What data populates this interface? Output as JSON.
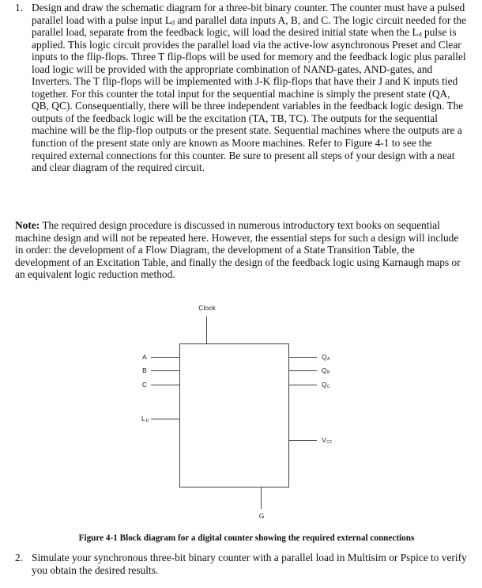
{
  "document": {
    "item1": {
      "number": "1.",
      "text_before_ld1": "Design and draw the schematic diagram for a three-bit binary counter. The counter must have a pulsed parallel load with a pulse input L",
      "ld_sub": "d",
      "text_between": " and parallel data inputs A, B, and C.  The logic circuit needed for the parallel load, separate from the feedback logic, will load the desired initial state when the L",
      "text_after": " pulse is applied. This logic circuit provides the parallel load via the active-low asynchronous Preset and Clear inputs to the flip-flops. Three T flip-flops will be used for memory and the feedback logic plus parallel load logic will be provided with the appropriate combination of NAND-gates, AND-gates, and Inverters. The T flip-flops will be implemented with J-K flip-flops that have their J and K inputs tied together. For this counter the total input for the sequential machine is simply the present state (QA, QB, QC). Consequentially, there will be three independent variables in the feedback logic design. The outputs of the feedback logic will be the excitation (TA, TB, TC).  The outputs for the sequential machine will be the flip-flop outputs or the present state. Sequential machines where the outputs are a function of the present state only are known as Moore machines. Refer to Figure 4-1 to see the required external connections for this counter.  Be sure to present all steps of your design with a neat and clear diagram of the required circuit."
    },
    "note": {
      "label": "Note:",
      "text": " The required design procedure is discussed in numerous introductory text books on sequential machine design and will not be repeated here. However, the essential steps for such a design will include in order: the development of a Flow Diagram, the development of a State Transition Table, the development of an Excitation Table, and finally the design of the feedback logic using Karnaugh maps or an equivalent logic reduction method."
    },
    "figure": {
      "clock_label": "Clock",
      "inputs": [
        {
          "label": "A",
          "sub": ""
        },
        {
          "label": "B",
          "sub": ""
        },
        {
          "label": "C",
          "sub": ""
        },
        {
          "label": "L",
          "sub": "D"
        }
      ],
      "outputs": [
        {
          "label": "Q",
          "sub": "A"
        },
        {
          "label": "Q",
          "sub": "B"
        },
        {
          "label": "Q",
          "sub": "C"
        },
        {
          "label": "V",
          "sub": "CC"
        }
      ],
      "ground_label": "G",
      "caption": "Figure 4-1 Block diagram for a digital counter showing the required external connections"
    },
    "item2": {
      "number": "2.",
      "text": "Simulate your synchronous three-bit binary counter with a parallel load in Multisim or Pspice to verify you obtain the desired results."
    }
  }
}
